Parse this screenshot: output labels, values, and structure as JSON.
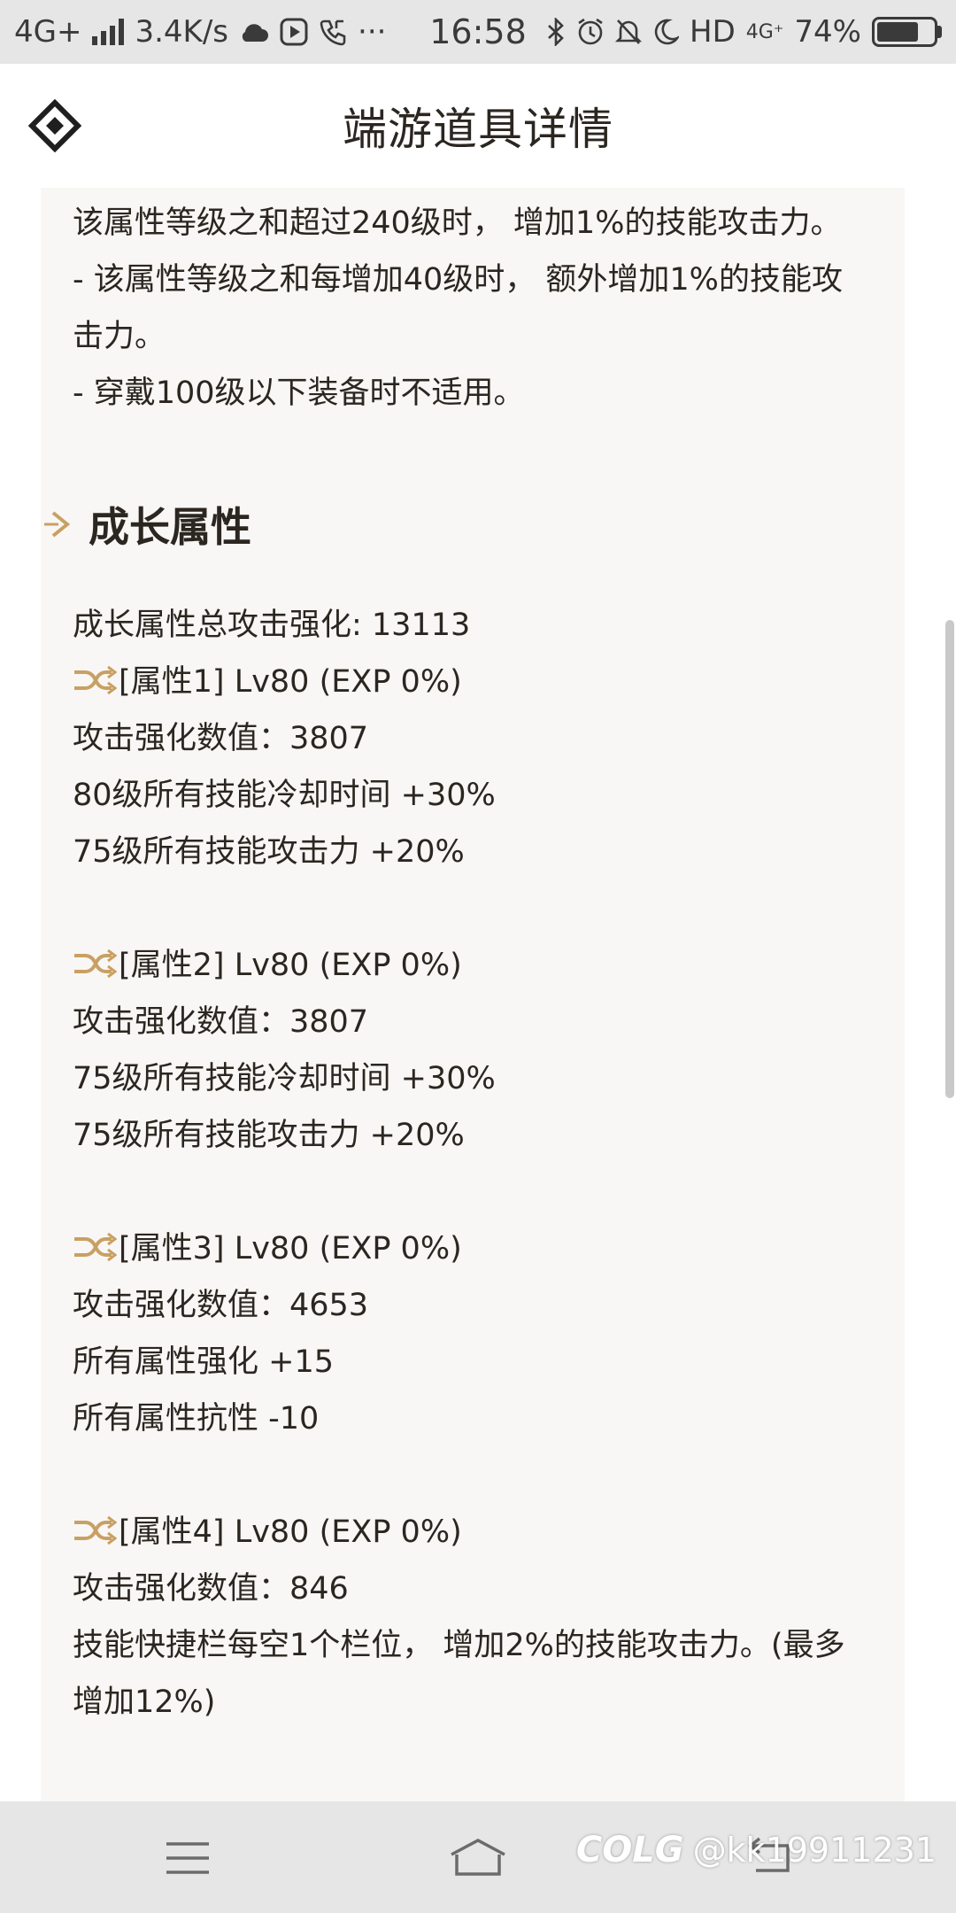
{
  "status_bar": {
    "network": "4G+",
    "speed": "3.4K/s",
    "more": "···",
    "time": "16:58",
    "hd": "HD",
    "network2": "4G⁺",
    "battery_level": 0.74,
    "battery_text": "74%",
    "icons": [
      "cloud-icon",
      "media-icon",
      "phone-icon",
      "bluetooth-icon",
      "alarm-icon",
      "mute-icon",
      "moon-icon"
    ]
  },
  "header": {
    "title": "端游道具详情",
    "logo_icon": "diamond-logo-icon"
  },
  "top_card": {
    "lines": [
      "该属性等级之和超过240级时， 增加1%的技能攻击力。",
      "- 该属性等级之和每增加40级时， 额外增加1%的技能攻",
      "击力。",
      "- 穿戴100级以下装备时不适用。"
    ]
  },
  "growth_section": {
    "title": "成长属性",
    "total_line": "成长属性总攻击强化: 13113",
    "attributes": [
      {
        "header": "[属性1] Lv80 (EXP 0%)",
        "lines": [
          "攻击强化数值：3807",
          "80级所有技能冷却时间 +30%",
          "75级所有技能攻击力 +20%"
        ]
      },
      {
        "header": "[属性2] Lv80 (EXP 0%)",
        "lines": [
          "攻击强化数值：3807",
          "75级所有技能冷却时间 +30%",
          "75级所有技能攻击力 +20%"
        ]
      },
      {
        "header": "[属性3] Lv80 (EXP 0%)",
        "lines": [
          "攻击强化数值：4653",
          "所有属性强化 +15",
          "所有属性抗性 -10"
        ]
      },
      {
        "header": "[属性4] Lv80 (EXP 0%)",
        "lines": [
          "攻击强化数值：846",
          "技能快捷栏每空1个栏位， 增加2%的技能攻击力。(最多",
          "增加12%)"
        ]
      }
    ]
  },
  "nav_bar": {
    "buttons": [
      "menu-icon",
      "home-icon",
      "back-icon"
    ]
  },
  "watermark": {
    "logo": "COLG",
    "user": "@kk19911231"
  },
  "colors": {
    "accent_gold": "#c9a063",
    "card_bg": "#f8f7f5",
    "text": "#2b2620",
    "status_bg": "#e6e6e6"
  }
}
